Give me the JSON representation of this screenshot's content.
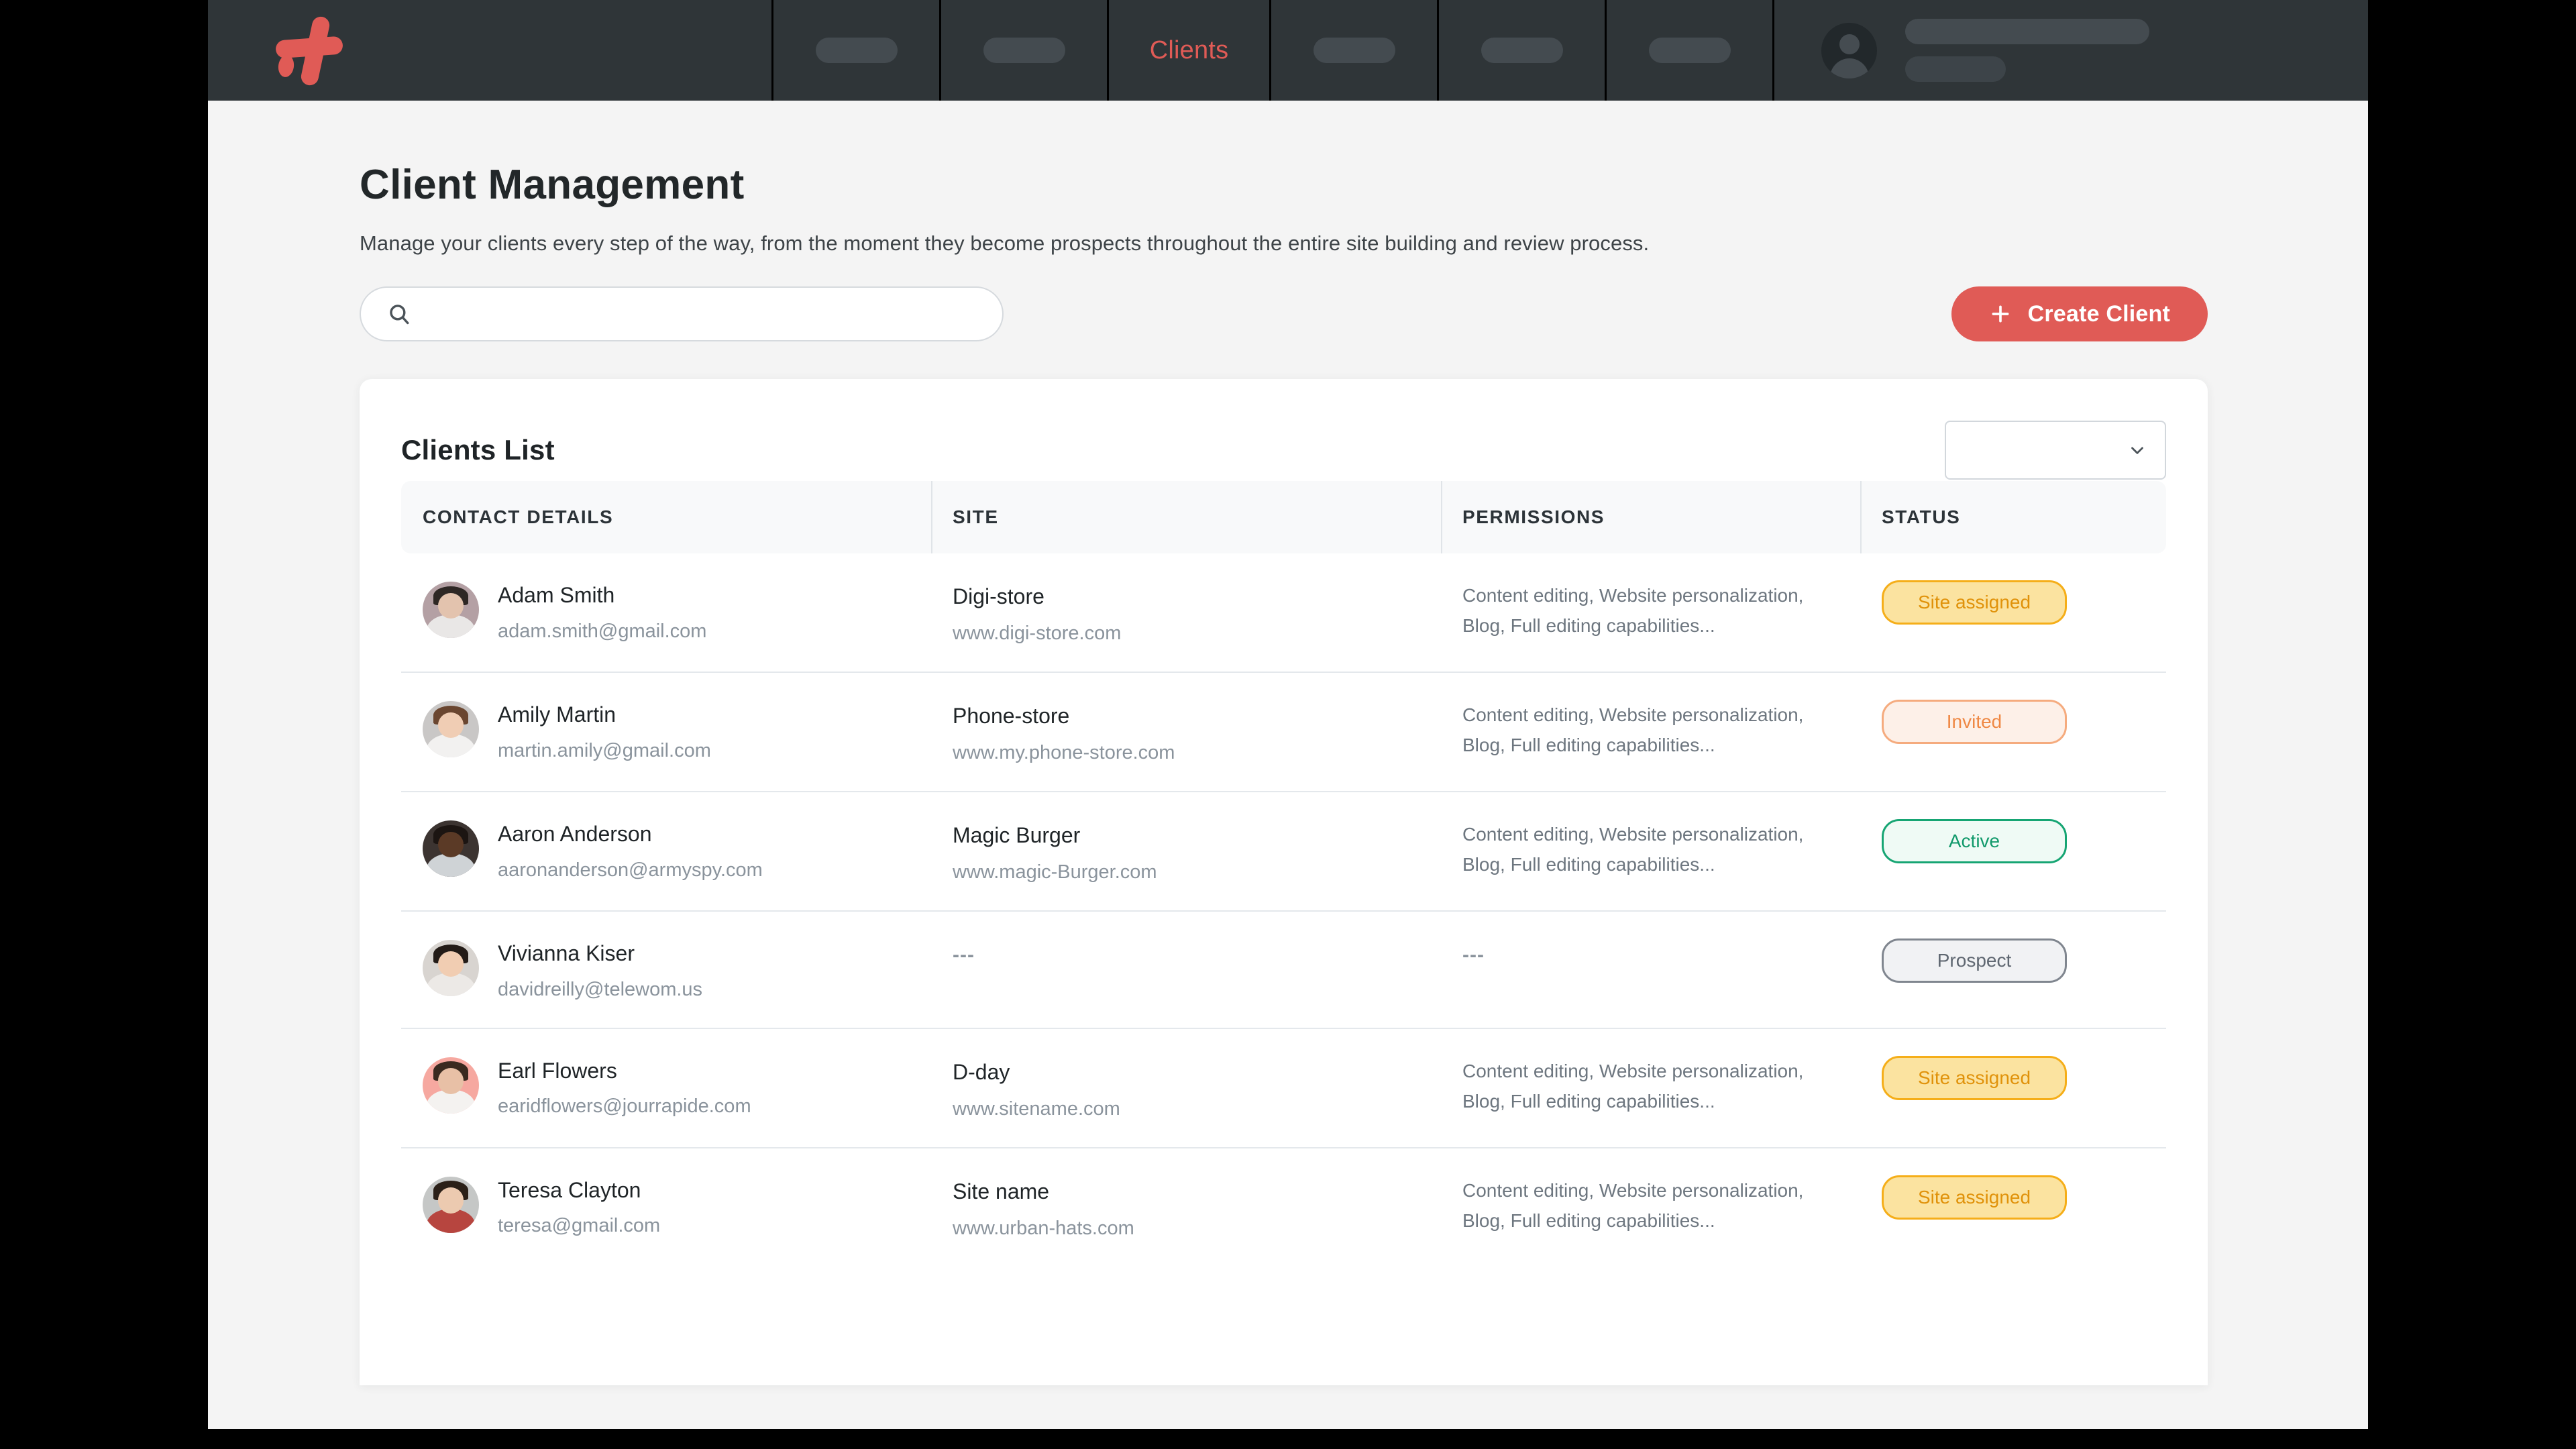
{
  "nav": {
    "logo_name": "brand-logo",
    "placeholder_items": [
      "",
      "",
      "",
      "",
      ""
    ],
    "active_item": "Clients",
    "user": {
      "avatar": "user-avatar-placeholder"
    }
  },
  "page": {
    "title": "Client Management",
    "subtitle": "Manage your clients every step of the way, from the moment they become prospects throughout the entire site building and review process."
  },
  "toolbar": {
    "search_value": "",
    "search_placeholder": "",
    "create_label": "Create Client"
  },
  "card": {
    "title": "Clients List",
    "filter_value": "",
    "columns": [
      "CONTACT DETAILS",
      "SITE",
      "PERMISSIONS",
      "STATUS"
    ]
  },
  "colors": {
    "brand_red": "#e05b56",
    "nav_bg": "#2f3538",
    "page_bg": "#f4f4f4",
    "status_site_assigned": "#f5ae19",
    "status_invited": "#ef8844",
    "status_active": "#16a573",
    "status_prospect": "#80868f"
  },
  "rows": [
    {
      "name": "Adam Smith",
      "email": "adam.smith@gmail.com",
      "site": "Digi-store",
      "url": "www.digi-store.com",
      "permissions": "Content editing, Website personalization, Blog, Full editing capabilities...",
      "status": "Site assigned",
      "status_class": "site-assigned",
      "avatar": {
        "bg": "#b4a0a4",
        "skin": "#e3c3ae",
        "hair": "#2e2724",
        "shirt": "#e9e7e6"
      }
    },
    {
      "name": "Amily Martin",
      "email": "martin.amily@gmail.com",
      "site": "Phone-store",
      "url": "www.my.phone-store.com",
      "permissions": "Content editing, Website personalization, Blog, Full editing capabilities...",
      "status": "Invited",
      "status_class": "invited",
      "avatar": {
        "bg": "#c9c7c6",
        "skin": "#f0cdb4",
        "hair": "#6a4630",
        "shirt": "#f2f1f0"
      }
    },
    {
      "name": "Aaron Anderson",
      "email": "aaronanderson@armyspy.com",
      "site": "Magic Burger",
      "url": "www.magic-Burger.com",
      "permissions": "Content editing, Website personalization, Blog, Full editing capabilities...",
      "status": "Active",
      "status_class": "active",
      "avatar": {
        "bg": "#3c3431",
        "skin": "#5b3a26",
        "hair": "#1c1512",
        "shirt": "#cfd3d6"
      }
    },
    {
      "name": "Vivianna Kiser",
      "email": "davidreilly@telewom.us",
      "site": "---",
      "url": "",
      "permissions": "---",
      "status": "Prospect",
      "status_class": "prospect",
      "avatar": {
        "bg": "#d8d4d0",
        "skin": "#f1cdb2",
        "hair": "#231b17",
        "shirt": "#ece9e6"
      }
    },
    {
      "name": "Earl Flowers",
      "email": "earidflowers@jourrapide.com",
      "site": "D-day",
      "url": "www.sitename.com",
      "permissions": "Content editing, Website personalization, Blog, Full editing capabilities...",
      "status": "Site assigned",
      "status_class": "site-assigned",
      "avatar": {
        "bg": "#f6a8a0",
        "skin": "#e8c0a6",
        "hair": "#3a2a20",
        "shirt": "#f4f2f0"
      }
    },
    {
      "name": "Teresa Clayton",
      "email": "teresa@gmail.com",
      "site": "Site name",
      "url": "www.urban-hats.com",
      "permissions": "Content editing, Website personalization, Blog, Full editing capabilities...",
      "status": "Site assigned",
      "status_class": "site-assigned",
      "avatar": {
        "bg": "#c5c7c6",
        "skin": "#eccab0",
        "hair": "#2b2018",
        "shirt": "#b7453f"
      }
    }
  ]
}
